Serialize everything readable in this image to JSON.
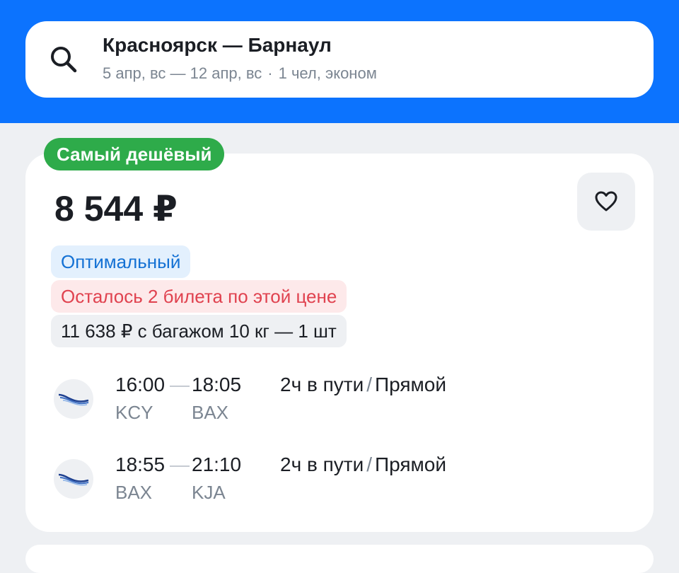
{
  "search": {
    "route": "Красноярск — Барнаул",
    "dates": "5 апр, вс — 12 апр, вс",
    "separator": "·",
    "passengers": "1 чел, эконом",
    "icon": "search-icon"
  },
  "offer": {
    "badge": "Самый дешёвый",
    "price": "8 544 ₽",
    "favorite_icon": "heart-icon",
    "chips": {
      "optimal": "Оптимальный",
      "tickets_left": "Осталось 2 билета по этой цене",
      "baggage": "11 638 ₽ с багажом 10 кг — 1 шт"
    },
    "segments": [
      {
        "dep_time": "16:00",
        "arr_time": "18:05",
        "dep_code": "KCY",
        "arr_code": "BAX",
        "duration": "2ч в пути",
        "sep": "/",
        "type": "Прямой"
      },
      {
        "dep_time": "18:55",
        "arr_time": "21:10",
        "dep_code": "BAX",
        "arr_code": "KJA",
        "duration": "2ч в пути",
        "sep": "/",
        "type": "Прямой"
      }
    ]
  },
  "colors": {
    "header_blue": "#0c73fe",
    "badge_green": "#2eab4a",
    "optimal_blue": "#1471d4",
    "warning_red": "#e0424f"
  }
}
